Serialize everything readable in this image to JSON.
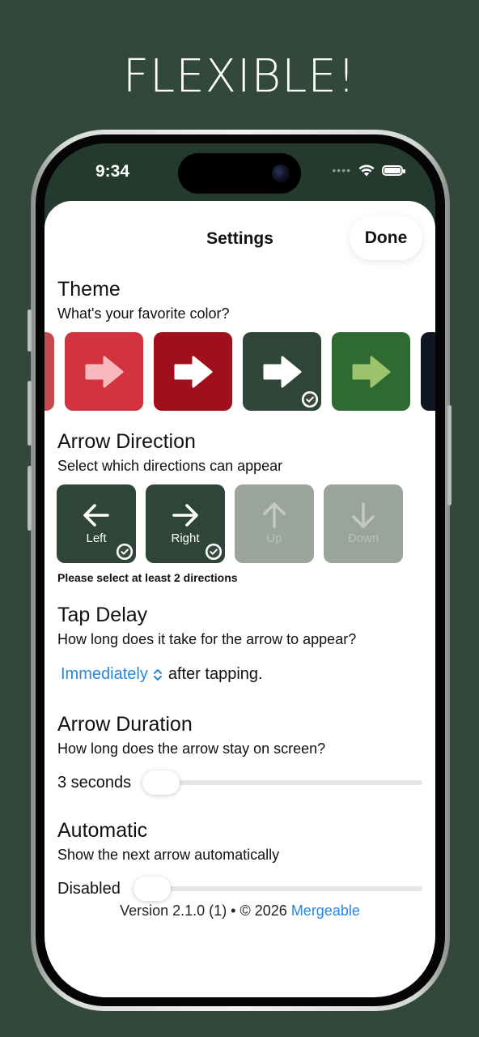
{
  "promo": {
    "headline": "FLEXIBLE!"
  },
  "status_bar": {
    "time": "9:34"
  },
  "nav": {
    "title": "Settings",
    "done_label": "Done"
  },
  "theme": {
    "title": "Theme",
    "subtitle": "What's your favorite color?",
    "swatches": [
      {
        "bg": "#c94a4a",
        "arrow": "#f2b2b2",
        "selected": false
      },
      {
        "bg": "#d2343f",
        "arrow": "#f7b9bd",
        "selected": false
      },
      {
        "bg": "#a0101c",
        "arrow": "#ffffff",
        "selected": false
      },
      {
        "bg": "#2e4537",
        "arrow": "#ffffff",
        "selected": true
      },
      {
        "bg": "#2e6a31",
        "arrow": "#9cc46c",
        "selected": false
      },
      {
        "bg": "#111722",
        "arrow": "#ffffff",
        "selected": false
      }
    ]
  },
  "arrow_direction": {
    "title": "Arrow Direction",
    "subtitle": "Select which directions can appear",
    "options": [
      {
        "label": "Left",
        "selected": true,
        "icon": "arrow-left-icon"
      },
      {
        "label": "Right",
        "selected": true,
        "icon": "arrow-right-icon"
      },
      {
        "label": "Up",
        "selected": false,
        "icon": "arrow-up-icon"
      },
      {
        "label": "Down",
        "selected": false,
        "icon": "arrow-down-icon"
      }
    ],
    "warning": "Please select at least 2 directions"
  },
  "tap_delay": {
    "title": "Tap Delay",
    "subtitle": "How long does it take for the arrow to appear?",
    "selected": "Immediately",
    "suffix": "after tapping."
  },
  "arrow_duration": {
    "title": "Arrow Duration",
    "subtitle": "How long does the arrow stay on screen?",
    "value_label": "3 seconds",
    "level": 0.0
  },
  "automatic": {
    "title": "Automatic",
    "subtitle": "Show the next arrow automatically",
    "value_label": "Disabled",
    "level": 0.0
  },
  "footer": {
    "version_text": "Version 2.1.0 (1) • © 2026",
    "link_text": "Mergeable"
  },
  "colors": {
    "accent_link": "#2a86d6",
    "background": "#33483c"
  }
}
